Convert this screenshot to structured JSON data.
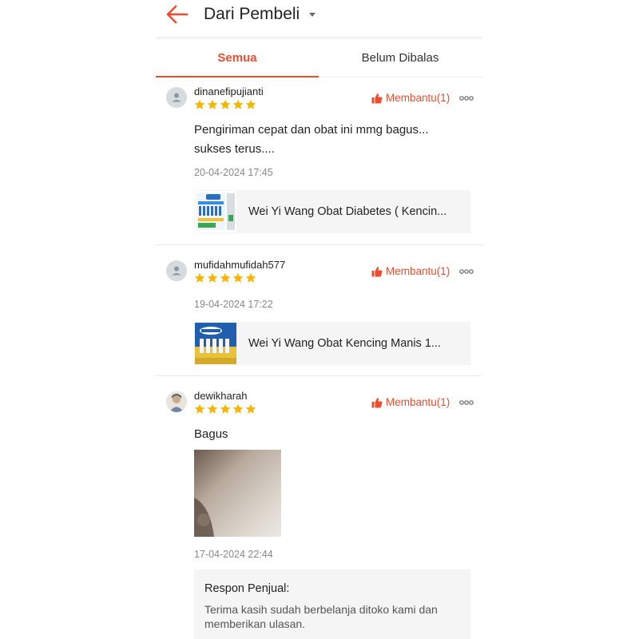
{
  "header": {
    "title": "Dari Pembeli",
    "back_icon": "arrow-left-icon",
    "dropdown_icon": "caret-down-icon"
  },
  "tabs": [
    {
      "label": "Semua",
      "active": true
    },
    {
      "label": "Belum Dibalas",
      "active": false
    }
  ],
  "colors": {
    "accent": "#ee4d2d",
    "star": "#f7b500"
  },
  "reviews": [
    {
      "username": "dinanefipujianti",
      "rating": 5,
      "helpful_label": "Membantu(1)",
      "comment": "Pengiriman cepat dan obat ini mmg bagus...\nsukses terus....",
      "date": "20-04-2024 17:45",
      "product": "Wei Yi Wang Obat Diabetes ( Kencin..."
    },
    {
      "username": "mufidahmufidah577",
      "rating": 5,
      "helpful_label": "Membantu(1)",
      "date": "19-04-2024 17:22",
      "product": "Wei Yi Wang Obat Kencing Manis 1..."
    },
    {
      "username": "dewikharah",
      "rating": 5,
      "helpful_label": "Membantu(1)",
      "comment": "Bagus",
      "date": "17-04-2024 22:44",
      "seller_response": {
        "title": "Respon Penjual:",
        "text": "Terima kasih sudah berbelanja ditoko kami dan memberikan ulasan."
      }
    }
  ]
}
